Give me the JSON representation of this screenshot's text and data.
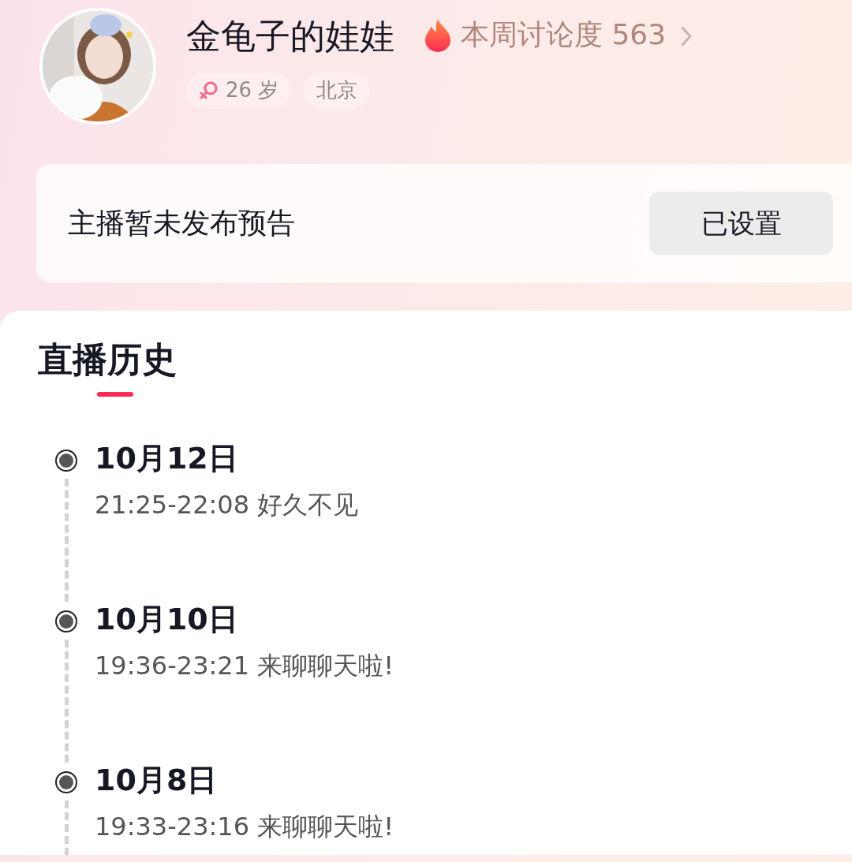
{
  "profile": {
    "name": "金龟子的娃娃",
    "heat": "本周讨论度 563",
    "tags": [
      {
        "kind": "gender",
        "text": "26 岁"
      },
      {
        "kind": "plain",
        "text": "北京"
      }
    ]
  },
  "notice": {
    "text": "主播暂未发布预告",
    "button": "已设置"
  },
  "history": {
    "tab": {
      "label": "直播历史",
      "selected": true
    },
    "entries": [
      {
        "date": "10月12日",
        "detail": "21:25-22:08 好久不见"
      },
      {
        "date": "10月10日",
        "detail": "19:36-23:21 来聊聊天啦!"
      },
      {
        "date": "10月8日",
        "detail": "19:33-23:16 来聊聊天啦!"
      }
    ]
  }
}
